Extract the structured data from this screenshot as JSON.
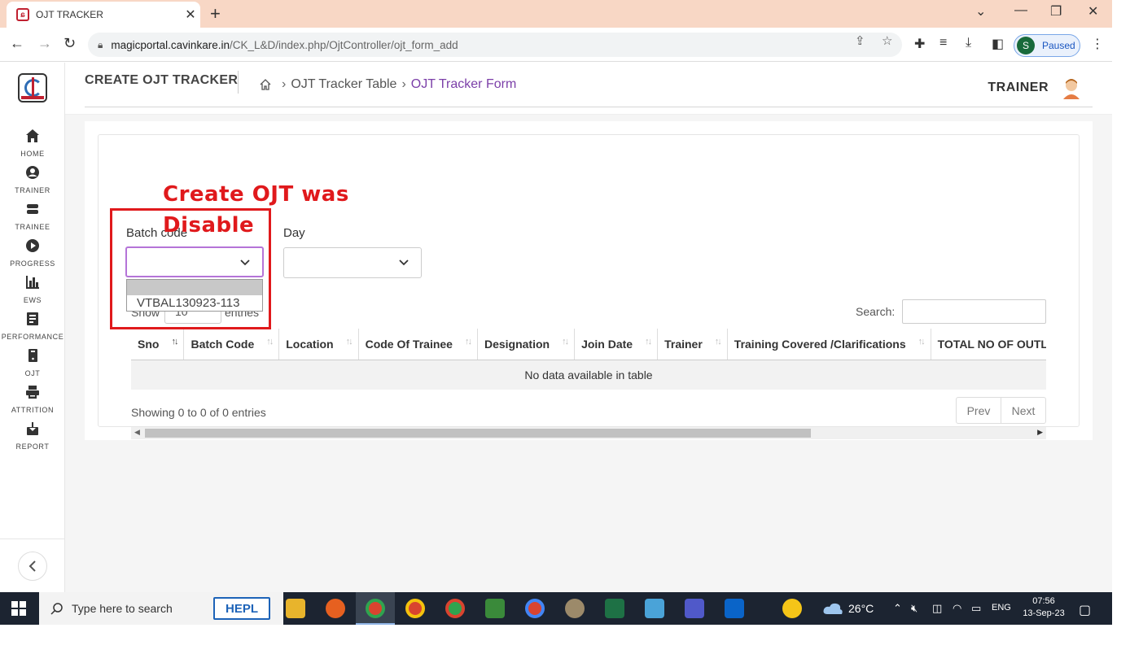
{
  "browser": {
    "tab_title": "OJT TRACKER",
    "url_host": "magicportal.cavinkare.in",
    "url_path": "/CK_L&D/index.php/OjtController/ojt_form_add",
    "profile_initial": "S",
    "profile_status": "Paused"
  },
  "sidebar": {
    "items": [
      {
        "label": "HOME",
        "icon": "home-icon"
      },
      {
        "label": "TRAINER",
        "icon": "user-circle-icon"
      },
      {
        "label": "TRAINEE",
        "icon": "layers-icon"
      },
      {
        "label": "PROGRESS",
        "icon": "play-circle-icon"
      },
      {
        "label": "EWS",
        "icon": "bar-chart-icon"
      },
      {
        "label": "PERFORMANCE",
        "icon": "report-icon"
      },
      {
        "label": "OJT",
        "icon": "document-icon"
      },
      {
        "label": "ATTRITION",
        "icon": "printer-icon"
      },
      {
        "label": "REPORT",
        "icon": "download-icon"
      }
    ]
  },
  "header": {
    "role": "TRAINER"
  },
  "page": {
    "title": "CREATE OJT TRACKER",
    "breadcrumb_parent": "OJT Tracker Table",
    "breadcrumb_current": "OJT Tracker Form"
  },
  "form": {
    "batch_code_label": "Batch code",
    "batch_code_value": "",
    "batch_code_options": [
      "",
      "VTBAL130923-113"
    ],
    "day_label": "Day",
    "day_value": ""
  },
  "table": {
    "show_label": "Show",
    "length_value": "10",
    "entries_label": "entries",
    "search_label": "Search:",
    "columns": [
      "Sno",
      "Batch Code",
      "Location",
      "Code Of Trainee",
      "Designation",
      "Join Date",
      "Trainer",
      "Training Covered /Clarifications",
      "TOTAL NO OF OUTLETS"
    ],
    "empty_message": "No data available in table",
    "info": "Showing 0 to 0 of 0 entries",
    "prev": "Prev",
    "next": "Next"
  },
  "annotation": {
    "line1": "Create OJT was",
    "line2": "Disable"
  },
  "taskbar": {
    "search_placeholder": "Type here to search",
    "hepl_label": "HEPL",
    "temperature": "26°C",
    "language": "ENG",
    "time": "07:56",
    "date": "13-Sep-23"
  }
}
